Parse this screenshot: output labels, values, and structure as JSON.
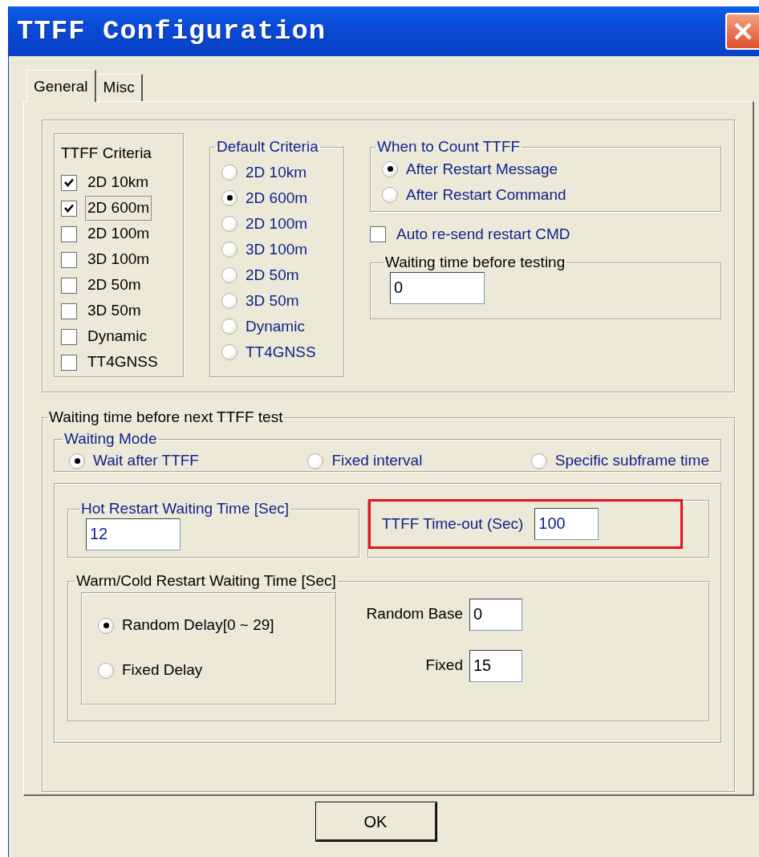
{
  "window": {
    "title": "TTFF Configuration"
  },
  "tabs": [
    {
      "label": "General",
      "selected": true
    },
    {
      "label": "Misc",
      "selected": false
    }
  ],
  "ttff_criteria": {
    "title": "TTFF Criteria",
    "items": [
      {
        "label": "2D 10km",
        "checked": true,
        "focused": false
      },
      {
        "label": "2D 600m",
        "checked": true,
        "focused": true
      },
      {
        "label": "2D 100m",
        "checked": false,
        "focused": false
      },
      {
        "label": "3D 100m",
        "checked": false,
        "focused": false
      },
      {
        "label": "2D 50m",
        "checked": false,
        "focused": false
      },
      {
        "label": "3D 50m",
        "checked": false,
        "focused": false
      },
      {
        "label": "Dynamic",
        "checked": false,
        "focused": false
      },
      {
        "label": "TT4GNSS",
        "checked": false,
        "focused": false
      }
    ]
  },
  "default_criteria": {
    "title": "Default Criteria",
    "options": [
      {
        "label": "2D 10km",
        "selected": false
      },
      {
        "label": "2D 600m",
        "selected": true
      },
      {
        "label": "2D 100m",
        "selected": false
      },
      {
        "label": "3D 100m",
        "selected": false
      },
      {
        "label": "2D 50m",
        "selected": false
      },
      {
        "label": "3D 50m",
        "selected": false
      },
      {
        "label": "Dynamic",
        "selected": false
      },
      {
        "label": "TT4GNSS",
        "selected": false
      }
    ]
  },
  "when_to_count": {
    "title": "When to Count TTFF",
    "options": [
      {
        "label": "After Restart Message",
        "selected": true
      },
      {
        "label": "After Restart Command",
        "selected": false
      }
    ]
  },
  "auto_resend": {
    "label": "Auto re-send restart CMD",
    "checked": false
  },
  "waiting_before_testing": {
    "title": "Waiting time before testing",
    "value": "0"
  },
  "next_test": {
    "title": "Waiting time before next TTFF test",
    "waiting_mode": {
      "title": "Waiting Mode",
      "options": [
        {
          "label": "Wait after TTFF",
          "selected": true
        },
        {
          "label": "Fixed interval",
          "selected": false
        },
        {
          "label": "Specific subframe time",
          "selected": false
        }
      ]
    },
    "hot_restart": {
      "title": "Hot Restart Waiting Time [Sec]",
      "value": "12"
    },
    "timeout": {
      "label": "TTFF Time-out (Sec)",
      "value": "100",
      "highlighted": true
    },
    "warm_cold": {
      "title": "Warm/Cold Restart Waiting Time [Sec]",
      "options": [
        {
          "label": "Random Delay[0 ~ 29]",
          "selected": true
        },
        {
          "label": "Fixed Delay",
          "selected": false
        }
      ],
      "random_base": {
        "label": "Random Base",
        "value": "0"
      },
      "fixed": {
        "label": "Fixed",
        "value": "15"
      }
    }
  },
  "buttons": [
    {
      "label": "OK"
    }
  ]
}
